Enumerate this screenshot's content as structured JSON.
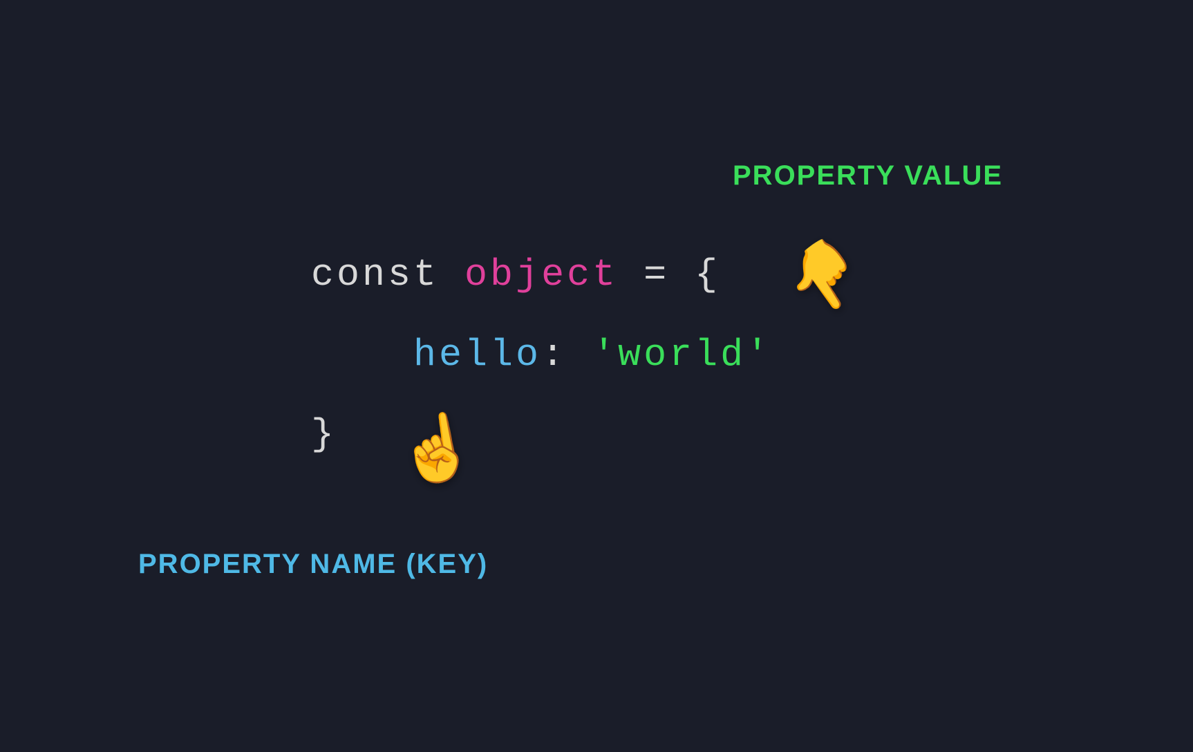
{
  "labels": {
    "propertyValue": "PROPERTY VALUE",
    "propertyKey": "PROPERTY NAME (KEY)"
  },
  "code": {
    "keyword": "const ",
    "identifier": "object",
    "assignOpen": " = {",
    "indent": "    ",
    "propKey": "hello",
    "colon": ": ",
    "propValue": "'world'",
    "close": "}"
  },
  "icons": {
    "handDownLeft": "👇",
    "handUp": "☝️"
  }
}
